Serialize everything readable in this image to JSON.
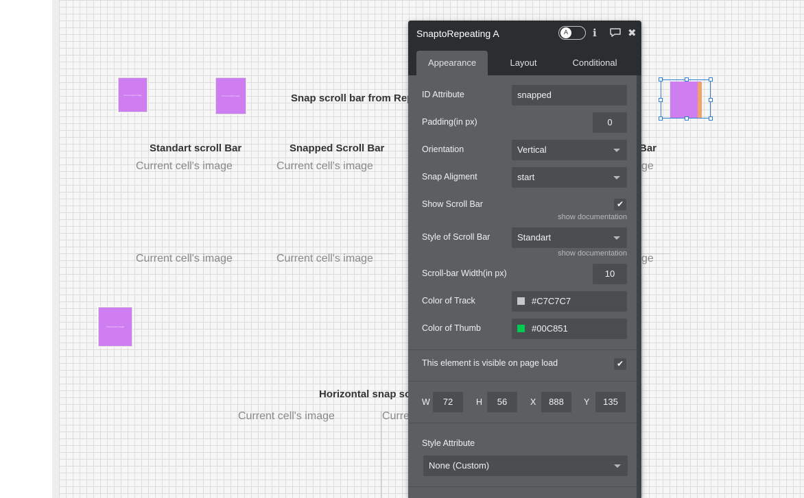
{
  "canvas": {
    "thumb_text": "Current cell's image",
    "headings": {
      "snap_from_rep": "Snap scroll bar from Rep",
      "standart": "Standart scroll Bar",
      "snapped": "Snapped Scroll Bar",
      "partial_bar": "Bar",
      "horizontal": "Horizontal snap sc"
    },
    "cell_labels": {
      "full": "Current cell's image",
      "partial_ge": "ge",
      "partial_curre": "Curre"
    }
  },
  "panel": {
    "title": "SnaptoRepeating A",
    "toggle_glyph": "A",
    "icons": [
      "info-icon",
      "comment-icon",
      "close-icon"
    ],
    "tabs": [
      "Appearance",
      "Layout",
      "Conditional"
    ],
    "active_tab": "Appearance",
    "fields": {
      "id_attribute": {
        "label": "ID Attribute",
        "value": "snapped"
      },
      "padding": {
        "label": "Padding(in px)",
        "value": "0"
      },
      "orientation": {
        "label": "Orientation",
        "value": "Vertical"
      },
      "snap_alignment": {
        "label": "Snap Aligment",
        "value": "start"
      },
      "show_scroll_bar": {
        "label": "Show Scroll Bar",
        "checked": true
      },
      "style_of_scroll_bar": {
        "label": "Style of Scroll Bar",
        "value": "Standart"
      },
      "scrollbar_width": {
        "label": "Scroll-bar Width(in px)",
        "value": "10"
      },
      "color_of_track": {
        "label": "Color of Track",
        "value": "#C7C7C7",
        "color": "#C7C7C7"
      },
      "color_of_thumb": {
        "label": "Color of Thumb",
        "value": "#00C851",
        "color": "#00C851"
      },
      "visible_on_load": {
        "label": "This element is visible on page load",
        "checked": true
      },
      "style_attribute": {
        "label": "Style Attribute",
        "value": "None (Custom)"
      }
    },
    "show_documentation": "show documentation",
    "dimensions": {
      "w_label": "W",
      "w": "72",
      "h_label": "H",
      "h": "56",
      "x_label": "X",
      "x": "888",
      "y_label": "Y",
      "y": "135"
    },
    "check_glyph": "✔",
    "close_glyph": "✖",
    "info_glyph": "ℹ",
    "comment_glyph": "💬"
  }
}
